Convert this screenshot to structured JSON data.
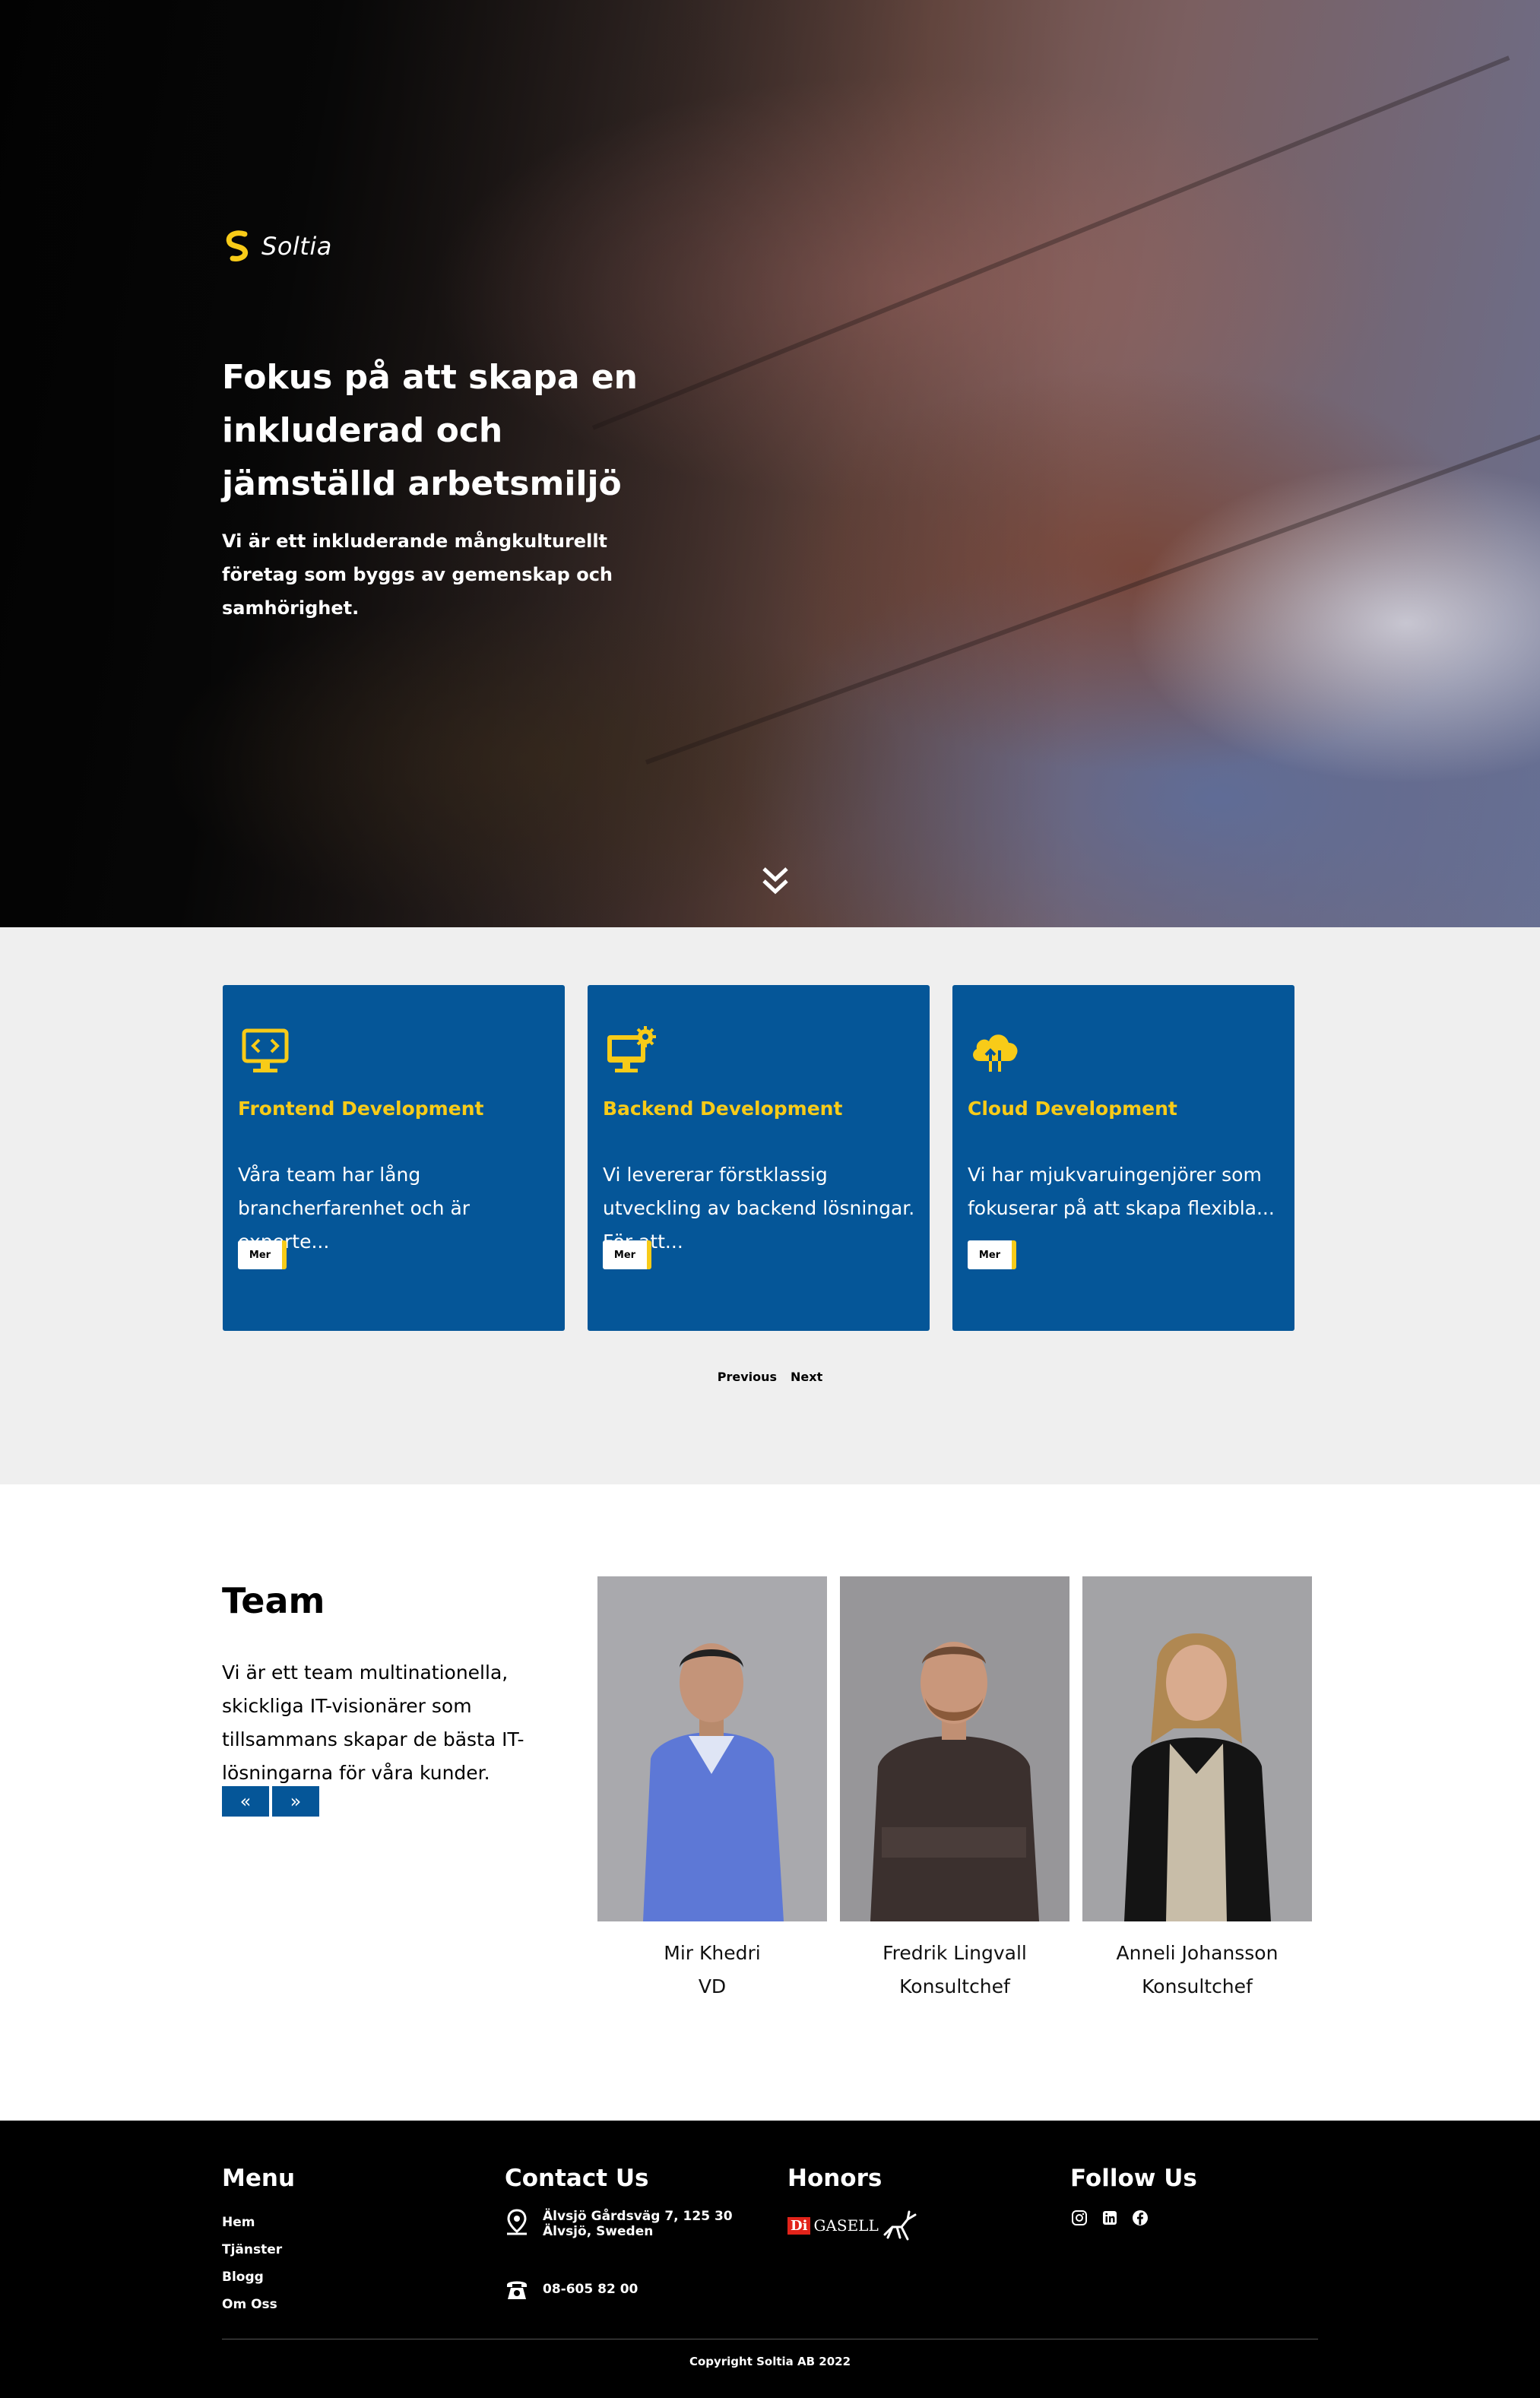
{
  "hero": {
    "logo_text": "Soltia",
    "title": "Fokus på att skapa en inkluderad och jämställd arbetsmiljö",
    "subtitle": "Vi är ett inkluderande mångkulturellt företag som byggs av gemenskap och samhörighet."
  },
  "services": {
    "cards": [
      {
        "title": "Frontend Development",
        "text": "Våra team har lång brancherfarenhet och är experte...",
        "button": "Mer",
        "icon": "monitor-code-icon"
      },
      {
        "title": "Backend Development",
        "text": "Vi levererar förstklassig utveckling av backend lösningar. För att...",
        "button": "Mer",
        "icon": "monitor-gear-icon"
      },
      {
        "title": "Cloud Development",
        "text": "Vi har mjukvaruingenjörer som fokuserar på att skapa flexibla...",
        "button": "Mer",
        "icon": "cloud-transfer-icon"
      }
    ],
    "prev_label": "Previous",
    "next_label": "Next"
  },
  "team": {
    "title": "Team",
    "text": "Vi är ett team multinationella, skickliga IT-visionärer som tillsammans skapar de bästa IT-lösningarna för våra kunder.",
    "prev_label": "«",
    "next_label": "»",
    "members": [
      {
        "name": "Mir Khedri",
        "role": "VD"
      },
      {
        "name": "Fredrik Lingvall",
        "role": "Konsultchef"
      },
      {
        "name": "Anneli Johansson",
        "role": "Konsultchef"
      }
    ]
  },
  "footer": {
    "menu_title": "Menu",
    "menu": [
      "Hem",
      "Tjänster",
      "Blogg",
      "Om Oss"
    ],
    "contact_title": "Contact Us",
    "address_line1": "Älvsjö Gårdsväg 7, 125 30",
    "address_line2": "Älvsjö, Sweden",
    "phone": "08-605 82 00",
    "honors_title": "Honors",
    "honors_di": "Di",
    "honors_gasell": "GASELL",
    "follow_title": "Follow Us",
    "social": [
      "instagram-icon",
      "linkedin-icon",
      "facebook-icon"
    ],
    "copyright": "Copyright Soltia AB 2022"
  },
  "colors": {
    "primary_blue": "#055698",
    "accent_yellow": "#f8cb18",
    "services_bg": "#efefef",
    "footer_bg": "#000000"
  }
}
